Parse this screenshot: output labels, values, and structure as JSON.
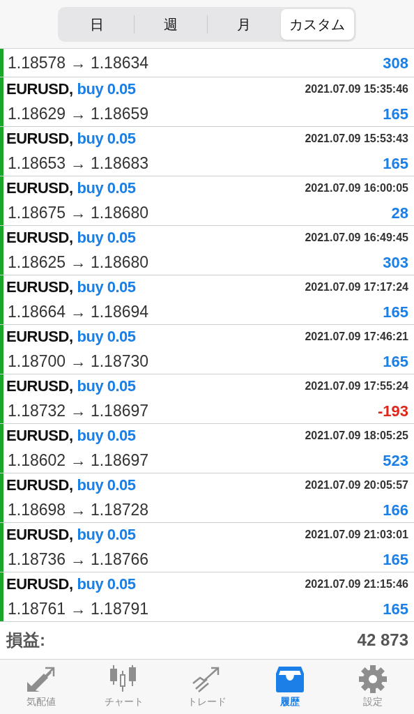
{
  "segments": [
    {
      "label": "日",
      "selected": false
    },
    {
      "label": "週",
      "selected": false
    },
    {
      "label": "月",
      "selected": false
    },
    {
      "label": "カスタム",
      "selected": true
    }
  ],
  "partial_row": {
    "prices": "1.18578 → 1.18634",
    "profit": "308",
    "color": "#1a7fe6"
  },
  "deals": [
    {
      "symbol": "EURUSD,",
      "order": "buy 0.05",
      "time": "2021.07.09 15:35:46",
      "prices": "1.18629 → 1.18659",
      "profit": "165",
      "color": "#1a7fe6"
    },
    {
      "symbol": "EURUSD,",
      "order": "buy 0.05",
      "time": "2021.07.09 15:53:43",
      "prices": "1.18653 → 1.18683",
      "profit": "165",
      "color": "#1a7fe6"
    },
    {
      "symbol": "EURUSD,",
      "order": "buy 0.05",
      "time": "2021.07.09 16:00:05",
      "prices": "1.18675 → 1.18680",
      "profit": "28",
      "color": "#1a7fe6"
    },
    {
      "symbol": "EURUSD,",
      "order": "buy 0.05",
      "time": "2021.07.09 16:49:45",
      "prices": "1.18625 → 1.18680",
      "profit": "303",
      "color": "#1a7fe6"
    },
    {
      "symbol": "EURUSD,",
      "order": "buy 0.05",
      "time": "2021.07.09 17:17:24",
      "prices": "1.18664 → 1.18694",
      "profit": "165",
      "color": "#1a7fe6"
    },
    {
      "symbol": "EURUSD,",
      "order": "buy 0.05",
      "time": "2021.07.09 17:46:21",
      "prices": "1.18700 → 1.18730",
      "profit": "165",
      "color": "#1a7fe6"
    },
    {
      "symbol": "EURUSD,",
      "order": "buy 0.05",
      "time": "2021.07.09 17:55:24",
      "prices": "1.18732 → 1.18697",
      "profit": "-193",
      "color": "#e0251b"
    },
    {
      "symbol": "EURUSD,",
      "order": "buy 0.05",
      "time": "2021.07.09 18:05:25",
      "prices": "1.18602 → 1.18697",
      "profit": "523",
      "color": "#1a7fe6"
    },
    {
      "symbol": "EURUSD,",
      "order": "buy 0.05",
      "time": "2021.07.09 20:05:57",
      "prices": "1.18698 → 1.18728",
      "profit": "166",
      "color": "#1a7fe6"
    },
    {
      "symbol": "EURUSD,",
      "order": "buy 0.05",
      "time": "2021.07.09 21:03:01",
      "prices": "1.18736 → 1.18766",
      "profit": "165",
      "color": "#1a7fe6"
    },
    {
      "symbol": "EURUSD,",
      "order": "buy 0.05",
      "time": "2021.07.09 21:15:46",
      "prices": "1.18761 → 1.18791",
      "profit": "165",
      "color": "#1a7fe6"
    }
  ],
  "summary": {
    "label": "損益:",
    "value": "42 873"
  },
  "tab_bar": [
    {
      "kind": "quotes",
      "label": "気配値",
      "selected": false
    },
    {
      "kind": "chart",
      "label": "チャート",
      "selected": false
    },
    {
      "kind": "trade",
      "label": "トレード",
      "selected": false
    },
    {
      "kind": "history",
      "label": "履歴",
      "selected": true
    },
    {
      "kind": "settings",
      "label": "設定",
      "selected": false
    }
  ]
}
